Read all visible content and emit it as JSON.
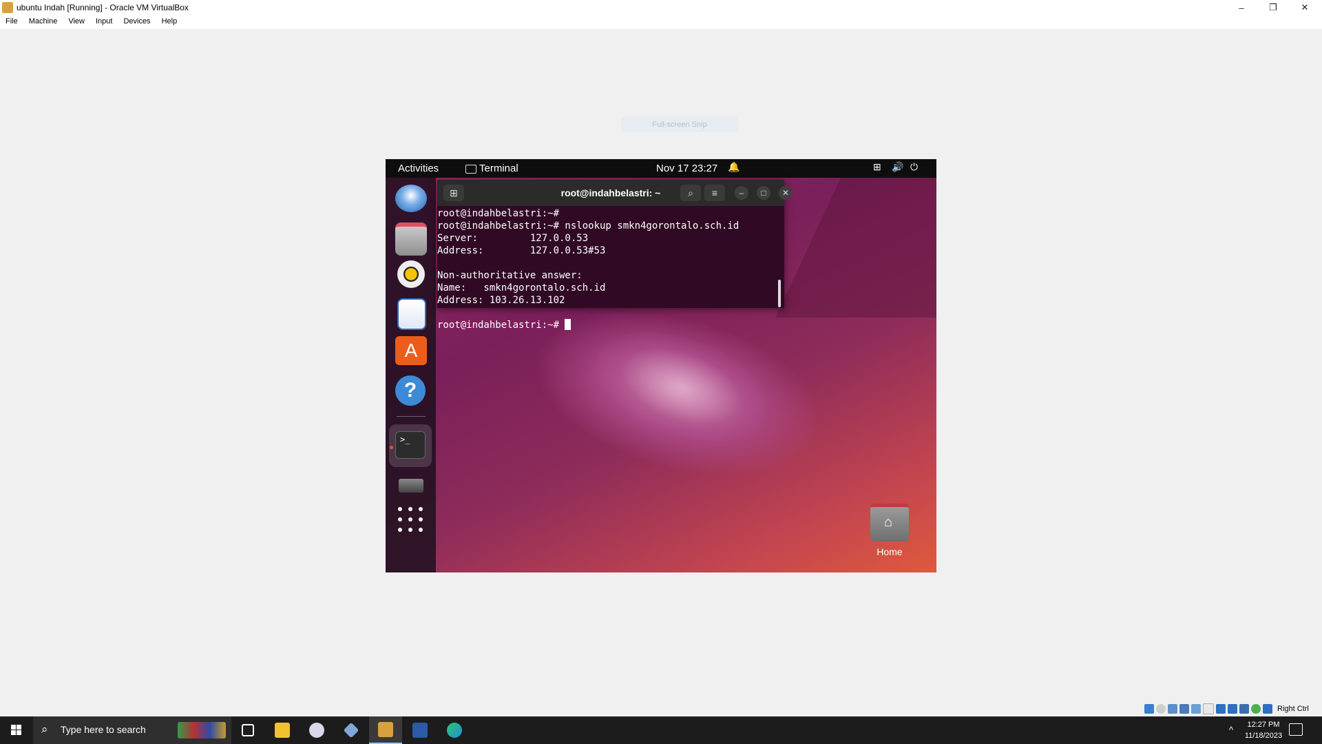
{
  "window": {
    "title": "ubuntu Indah [Running] - Oracle VM VirtualBox",
    "controls": [
      "–",
      "❐",
      "✕"
    ]
  },
  "menu": {
    "items": [
      "File",
      "Machine",
      "View",
      "Input",
      "Devices",
      "Help"
    ]
  },
  "fullscreen_tip": "Full-screen Snip",
  "ubuntu": {
    "topbar": {
      "activities": "Activities",
      "app_label": "Terminal",
      "clock": "Nov 17  23:27"
    },
    "dock": [
      "thunderbird-icon",
      "files-icon",
      "rhythmbox-icon",
      "writer-icon",
      "app-store-icon",
      "help-icon",
      "terminal-icon",
      "drive-icon",
      "app-grid-icon"
    ],
    "terminal": {
      "title": "root@indahbelastri: ~",
      "lines": [
        "root@indahbelastri:~#",
        "root@indahbelastri:~# nslookup smkn4gorontalo.sch.id",
        "Server:         127.0.0.53",
        "Address:        127.0.0.53#53",
        "",
        "Non-authoritative answer:",
        "Name:   smkn4gorontalo.sch.id",
        "Address: 103.26.13.102",
        ""
      ],
      "prompt": "root@indahbelastri:~# "
    },
    "desktop": {
      "home_label": "Home"
    }
  },
  "vbox_status": {
    "host_key": "Right Ctrl"
  },
  "taskbar": {
    "search_placeholder": "Type here to search",
    "time": "12:27 PM",
    "date": "11/18/2023",
    "tray_chevron": "^"
  }
}
